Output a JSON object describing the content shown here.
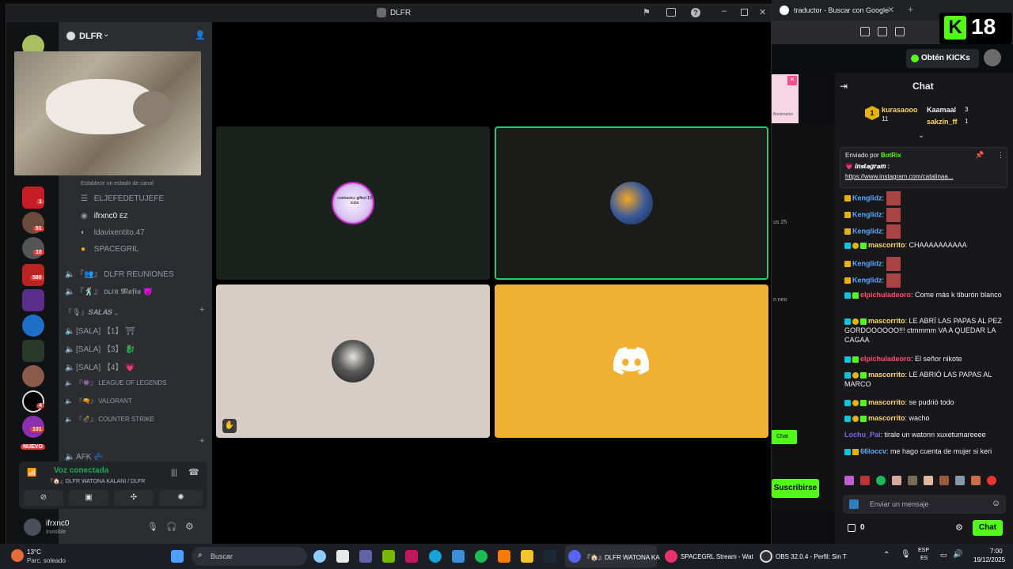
{
  "discord": {
    "window_title": "DLFR",
    "server_name": "DLFR",
    "status_placeholder": "Establece un estado de canal",
    "voice_members": [
      "ELJEFEDETUJEFE",
      "ifrxnc0",
      "ldavixentito.47",
      "SPACEGRIL"
    ],
    "member_tag": "EZ",
    "channels": [
      {
        "label": "DLFR REUNIONES",
        "prefix": "『👥』"
      },
      {
        "label": "ᴅʟғʀ 𝕸𝖆𝖋𝖎𝖆 👿",
        "prefix": "『🕺』"
      }
    ],
    "category_salas": "『🎙』𝑺𝑨𝑳𝑨𝑺",
    "salas": [
      "[SALA] 【1】 ⛩",
      "[SALA] 【3】 🐉",
      "[SALA] 【4】 💗"
    ],
    "games": [
      "LEAGUE OF LEGENDS",
      "VALORANT",
      "COUNTER STRIKE"
    ],
    "afk_label": "AFK 💤",
    "voice_connected": "Voz conectada",
    "voice_channel": "『🏠』DLFR WATONA KALANI / DLFR",
    "username": "ifrxnc0",
    "user_status": "Invisible",
    "guild_badges": [
      "1",
      "51",
      "10",
      "580",
      "4",
      "101",
      "NUEVO"
    ],
    "tile_text": "contrastcc gifted 10 subs"
  },
  "browser": {
    "tab_title": "traductor - Buscar con Google",
    "kick_age": "18",
    "kick_cta": "Obtén KICKs",
    "side_subscribe": "Suscribirse",
    "side_chat": "Chat",
    "side_fragments": [
      "Bookmarks",
      "us 25",
      "n neo"
    ]
  },
  "chat": {
    "title": "Chat",
    "gifters": [
      {
        "name": "kurasaooo",
        "count": "11"
      },
      {
        "name": "Kaamaal",
        "count": "3"
      },
      {
        "name": "sakzin_ff",
        "count": "1"
      }
    ],
    "pinned_by_label": "Enviado por",
    "pinned_by": "BotRix",
    "pinned_title": "💗 𝒊𝒏𝒔𝒕𝒂𝒈𝒓𝒂𝒎 :",
    "pinned_link": "https://www.instagram.com/catalinaa...",
    "messages": [
      {
        "user": "Kenglidz",
        "text": "",
        "color": "#5aa9ff"
      },
      {
        "user": "Kenglidz",
        "text": "",
        "color": "#5aa9ff"
      },
      {
        "user": "Kenglidz",
        "text": "",
        "color": "#5aa9ff"
      },
      {
        "user": "mascorrito",
        "text": "CHAAAAAAAAAA",
        "color": "#ffd66b"
      },
      {
        "user": "Kenglidz",
        "text": "",
        "color": "#5aa9ff"
      },
      {
        "user": "Kenglidz",
        "text": "",
        "color": "#5aa9ff"
      },
      {
        "user": "elpichuladeoro",
        "text": "Come más k tiburón blanco",
        "color": "#ff4d6d"
      },
      {
        "user": "mascorrito",
        "text": "LE ABRÍ LAS PAPAS AL PEZ GORDOOOOOO!!! ctmmmm VA A QUEDAR LA CAGAA",
        "color": "#ffd66b"
      },
      {
        "user": "elpichuladeoro",
        "text": "El señor nikote",
        "color": "#ff4d6d"
      },
      {
        "user": "mascorrito",
        "text": "LE ABRIÓ LAS PAPAS AL MARCO",
        "color": "#ffd66b"
      },
      {
        "user": "mascorrito",
        "text": "se pudrió todo",
        "color": "#ffd66b"
      },
      {
        "user": "mascorrito",
        "text": "wacho",
        "color": "#ffd66b"
      },
      {
        "user": "Lochu_Pai",
        "text": "tirale un watonn xuxetumareeee",
        "color": "#7b68ee"
      },
      {
        "user": "66loccv",
        "text": "me hago cuenta de mujer si keri",
        "color": "#5aa9ff"
      }
    ],
    "input_placeholder": "Enviar un mensaje",
    "points": "0",
    "chat_button": "Chat"
  },
  "taskbar": {
    "weather_temp": "13°C",
    "weather_desc": "Parc. soleado",
    "search_placeholder": "Buscar",
    "apps": [
      {
        "label": "『🏠』DLFR WATONA KA"
      },
      {
        "label": "SPACEGRL Stream - Wat"
      },
      {
        "label": "OBS 32.0.4 - Perfil: Sin T"
      }
    ],
    "lang1": "ESP",
    "lang2": "ES",
    "time": "7:00",
    "date": "19/12/2025"
  }
}
